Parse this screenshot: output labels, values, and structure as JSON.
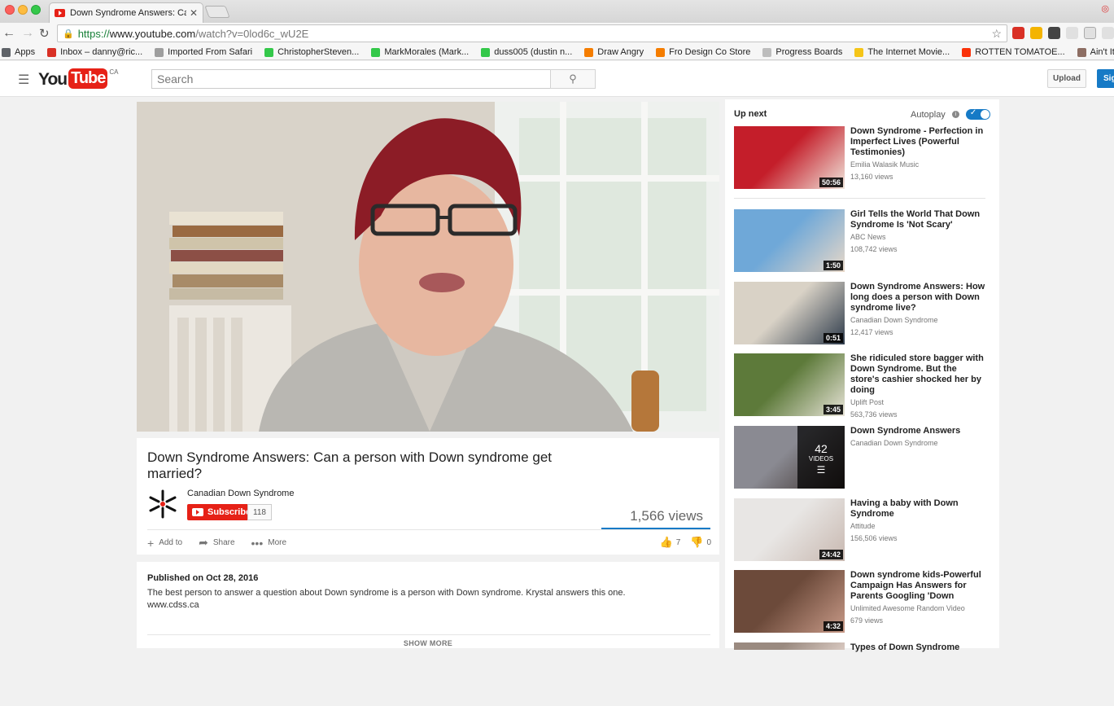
{
  "browser": {
    "tab_title": "Down Syndrome Answers: Can a person with Down syndrome get married?",
    "url_scheme": "https://",
    "url_host": "www.youtube.com",
    "url_path": "/watch?v=0lod6c_wU2E",
    "bookmarks": [
      {
        "label": "Apps",
        "icon": "apps-grid-icon",
        "color": "#5f6368"
      },
      {
        "label": "Inbox – danny@ric...",
        "icon": "gmail-icon",
        "color": "#d93025"
      },
      {
        "label": "Imported From Safari",
        "icon": "folder-icon",
        "color": "#9e9e9e"
      },
      {
        "label": "ChristopherSteven...",
        "icon": "green-x-icon",
        "color": "#34c84a"
      },
      {
        "label": "MarkMorales (Mark...",
        "icon": "green-x-icon",
        "color": "#34c84a"
      },
      {
        "label": "duss005 (dustin n...",
        "icon": "green-x-icon",
        "color": "#34c84a"
      },
      {
        "label": "Draw Angry",
        "icon": "blogger-icon",
        "color": "#f57d00"
      },
      {
        "label": "Fro Design Co Store",
        "icon": "blogger-icon",
        "color": "#f57d00"
      },
      {
        "label": "Progress Boards",
        "icon": "page-icon",
        "color": "#bdbdbd"
      },
      {
        "label": "The Internet Movie...",
        "icon": "imdb-icon",
        "color": "#f5c518"
      },
      {
        "label": "ROTTEN TOMATOE...",
        "icon": "tomato-icon",
        "color": "#fa320a"
      },
      {
        "label": "Ain't It Cool N",
        "icon": "poop-icon",
        "color": "#8d6e63"
      }
    ]
  },
  "header": {
    "logo_you": "You",
    "logo_tube": "Tube",
    "logo_region": "CA",
    "search_placeholder": "Search",
    "upload_label": "Upload",
    "signin_label": "Sig"
  },
  "video": {
    "title": "Down Syndrome Answers: Can a person with Down syndrome get married?",
    "channel": "Canadian Down Syndrome",
    "subscribe_label": "Subscribe",
    "subscriber_count": "118",
    "views": "1,566 views",
    "add_to_label": "Add to",
    "share_label": "Share",
    "more_label": "More",
    "likes": "7",
    "dislikes": "0",
    "published": "Published on Oct 28, 2016",
    "description": "The best person to answer a question about Down syndrome is a person with Down syndrome. Krystal answers this one.",
    "link": "www.cdss.ca",
    "show_more": "SHOW MORE"
  },
  "sidebar": {
    "up_next": "Up next",
    "autoplay": "Autoplay",
    "items": [
      {
        "title": "Down Syndrome - Perfection in Imperfect Lives (Powerful Testimonies)",
        "channel": "Emilia Walasik Music",
        "views": "13,160 views",
        "duration": "50:56"
      },
      {
        "title": "Girl Tells the World That Down Syndrome Is 'Not Scary'",
        "channel": "ABC News",
        "views": "108,742 views",
        "duration": "1:50"
      },
      {
        "title": "Down Syndrome Answers: How long does a person with Down syndrome live?",
        "channel": "Canadian Down Syndrome",
        "views": "12,417 views",
        "duration": "0:51"
      },
      {
        "title": "She ridiculed store bagger with Down Syndrome. But the store's cashier shocked her by doing",
        "channel": "Uplift Post",
        "views": "563,736 views",
        "duration": "3:45"
      },
      {
        "title": "Down Syndrome Answers",
        "channel": "Canadian Down Syndrome",
        "views": "",
        "duration": "",
        "playlist_count": "42",
        "playlist_label": "VIDEOS"
      },
      {
        "title": "Having a baby with Down Syndrome",
        "channel": "Attitude",
        "views": "156,506 views",
        "duration": "24:42"
      },
      {
        "title": "Down syndrome kids-Powerful Campaign Has Answers for Parents Googling 'Down",
        "channel": "Unlimited Awesome Random Video",
        "views": "679 views",
        "duration": "4:32"
      },
      {
        "title": "Types of Down Syndrome",
        "channel": "",
        "views": "",
        "duration": ""
      }
    ]
  },
  "colors": {
    "youtube_red": "#e62117",
    "accent_blue": "#167ac6"
  }
}
